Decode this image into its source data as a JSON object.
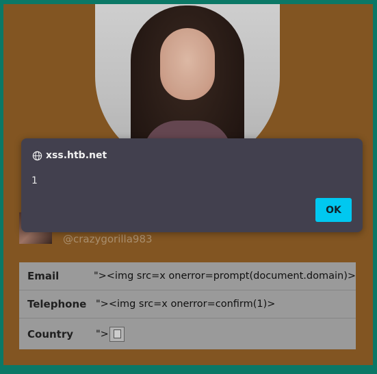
{
  "dialog": {
    "origin": "xss.htb.net",
    "message": "1",
    "ok_label": "OK"
  },
  "profile": {
    "handle": "@crazygorilla983"
  },
  "details": [
    {
      "label": "Email",
      "value": "\"><img src=x onerror=prompt(document.domain)>"
    },
    {
      "label": "Telephone",
      "value": "\"><img src=x onerror=confirm(1)>"
    },
    {
      "label": "Country",
      "value": "\">"
    }
  ],
  "colors": {
    "border": "#0c7f6c",
    "background": "#8a5a24",
    "dialog_bg": "#42404e",
    "ok_button": "#00c8f0"
  },
  "icons": {
    "origin": "globe-icon",
    "broken_image": "broken-image-icon"
  }
}
